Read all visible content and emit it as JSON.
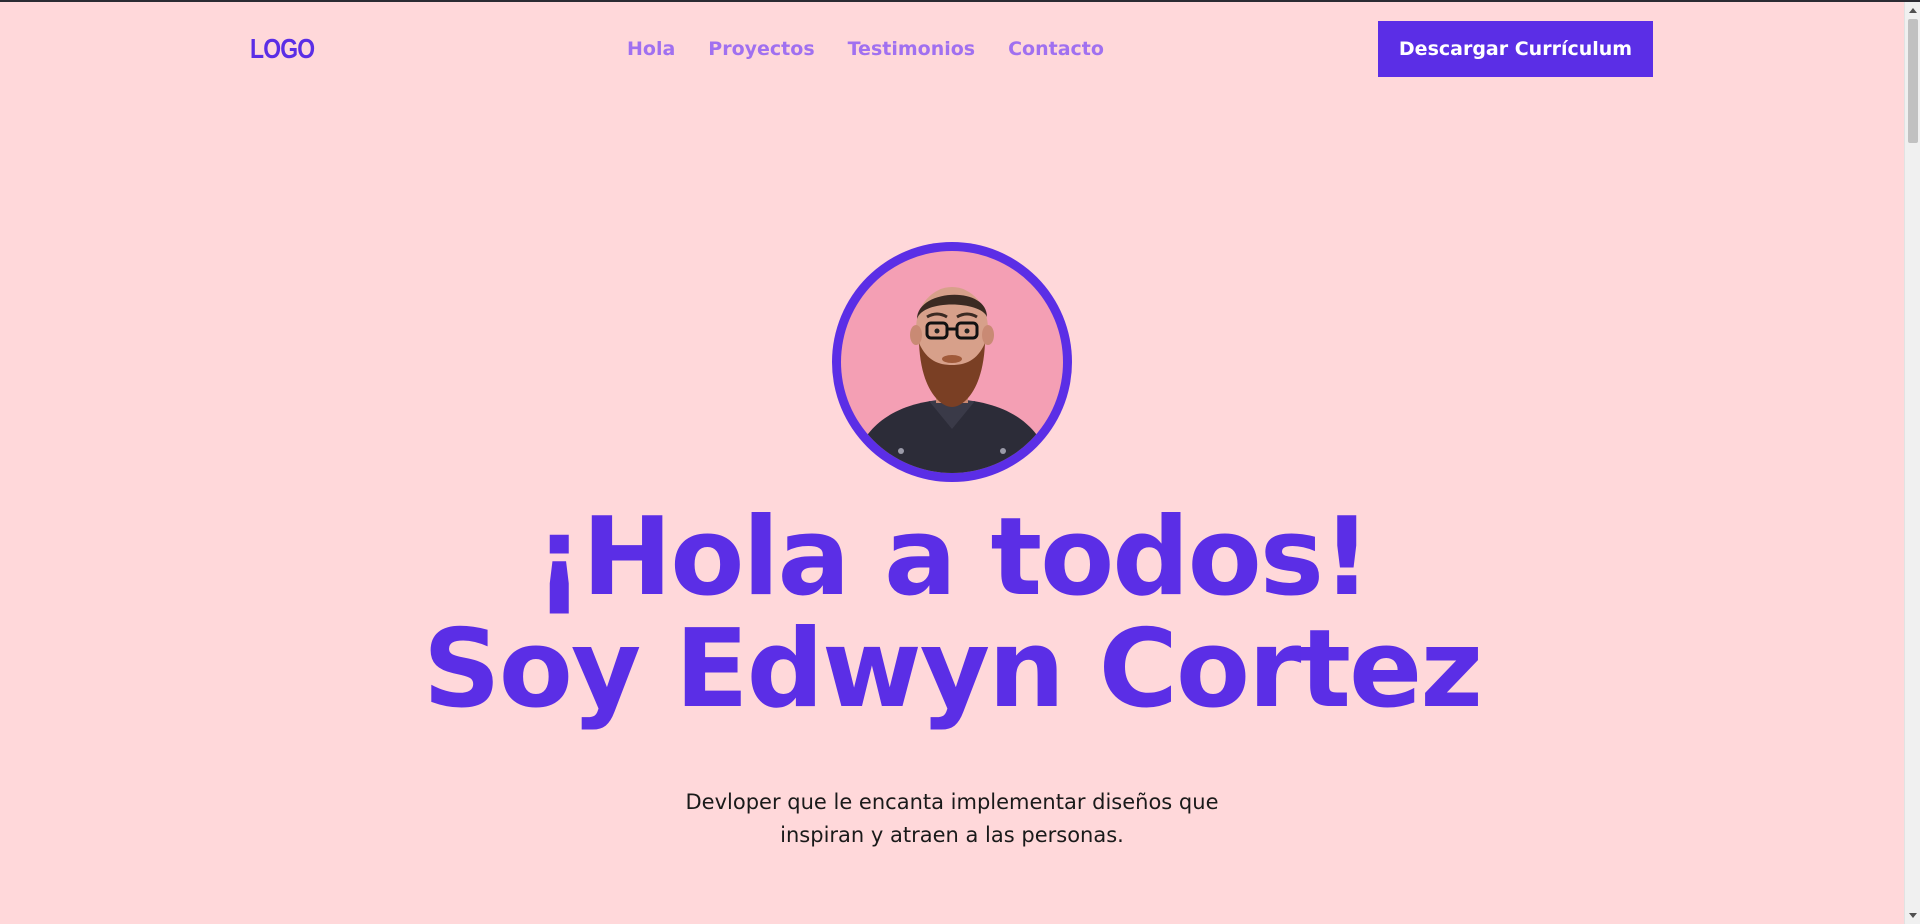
{
  "header": {
    "logo": "LOGO",
    "nav": [
      {
        "label": "Hola"
      },
      {
        "label": "Proyectos"
      },
      {
        "label": "Testimonios"
      },
      {
        "label": "Contacto"
      }
    ],
    "cta_label": "Descargar Currículum"
  },
  "hero": {
    "avatar_icon": "person-avatar",
    "title_line1": "¡Hola a todos!",
    "title_line2": "Soy Edwyn Cortez",
    "subtitle_line1": "Devloper que le encanta implementar diseños que",
    "subtitle_line2": "inspiran y atraen a las personas."
  },
  "colors": {
    "accent": "#5b2ee6",
    "nav_link": "#a070f0",
    "background": "#ffd8da",
    "avatar_bg": "#f49fb4"
  }
}
